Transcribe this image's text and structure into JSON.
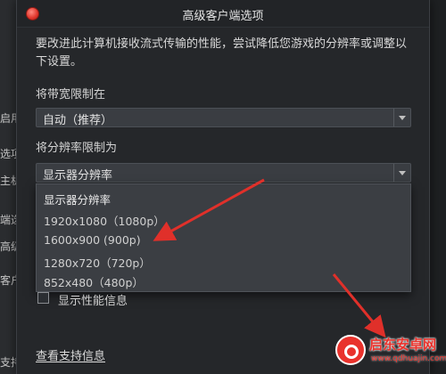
{
  "background_window": {
    "items": [
      "启用",
      "选项",
      "主机",
      "端选",
      "高级",
      "客户",
      "支持"
    ]
  },
  "dialog": {
    "title": "高级客户端选项",
    "description": "要改进此计算机接收流式传输的性能，尝试降低您游戏的分辨率或调整以下设置。",
    "bandwidth": {
      "label": "将带宽限制在",
      "selected": "自动（推荐）"
    },
    "resolution": {
      "label": "将分辨率限制为",
      "selected": "显示器分辨率",
      "options": [
        "显示器分辨率",
        "1920x1080（1080p）",
        "1600x900 (900p)",
        "1280x720（720p）",
        "852x480（480p）"
      ]
    },
    "performance_info": {
      "label": "显示性能信息",
      "checked": false
    },
    "support_link": "查看支持信息"
  },
  "watermark": {
    "title": "启东安卓网",
    "url": "www.qdhuajin.com"
  },
  "colors": {
    "dialog_bg": "#25272a",
    "control_bg": "#3a3d42",
    "arrow": "#e0302a"
  }
}
